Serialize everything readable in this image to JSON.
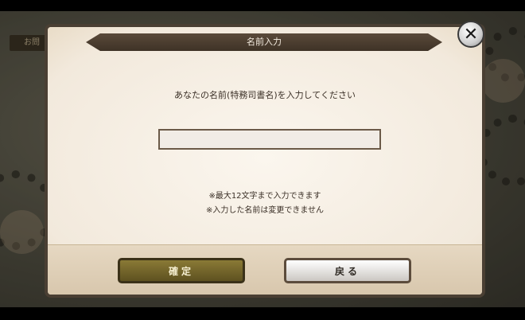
{
  "dialog": {
    "title": "名前入力",
    "prompt": "あなたの名前(特務司書名)を入力してください",
    "input_value": "",
    "input_placeholder": "",
    "note_limit": "※最大12文字まで入力できます",
    "note_fixed": "※入力した名前は変更できません",
    "confirm_label": "確定",
    "back_label": "戻る",
    "close_label": "✕"
  },
  "background": {
    "tab_label": "お問"
  },
  "colors": {
    "dialog_bg": "#f4ece0",
    "title_bar": "#4a3c2e",
    "confirm_button": "#6f6228",
    "back_button": "#e6e3df"
  }
}
